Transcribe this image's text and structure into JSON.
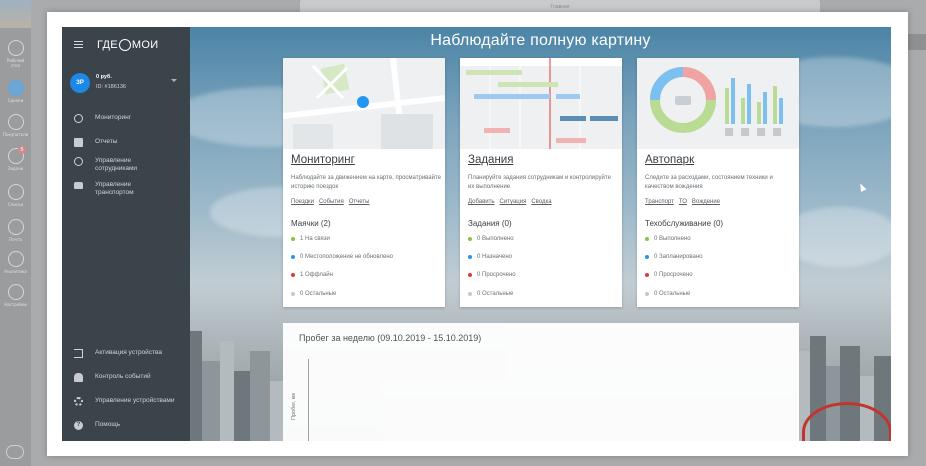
{
  "outer": {
    "tab_label": "Главная",
    "rail": [
      {
        "label": "Рабочий стол"
      },
      {
        "label": "Сделки"
      },
      {
        "label": "Покупатели"
      },
      {
        "label": "Задачи"
      },
      {
        "label": "Списки"
      },
      {
        "label": "Почта"
      },
      {
        "label": "Аналитика"
      },
      {
        "label": "Настройки"
      }
    ],
    "rail_badge": "5"
  },
  "sidebar": {
    "logo": {
      "left": "ГДЕ",
      "right": "МОИ"
    },
    "user": {
      "initials": "ЗР",
      "balance": "0 руб.",
      "account_id": "ID: #186136"
    },
    "nav": [
      {
        "label": "Мониторинг",
        "icon": "globe-icon"
      },
      {
        "label": "Отчеты",
        "icon": "document-icon"
      },
      {
        "label": "Управление сотрудниками",
        "icon": "person-icon"
      },
      {
        "label": "Управление транспортом",
        "icon": "car-icon"
      }
    ],
    "bottom_nav": [
      {
        "label": "Активация устройства",
        "icon": "exit-icon"
      },
      {
        "label": "Контроль событий",
        "icon": "bell-icon"
      },
      {
        "label": "Управление устройствами",
        "icon": "gear-icon"
      },
      {
        "label": "Помощь",
        "icon": "help-icon"
      }
    ]
  },
  "hero": {
    "title": "Наблюдайте полную картину"
  },
  "cards": [
    {
      "title": "Мониторинг",
      "description": "Наблюдайте за движением на карте, просматривайте историю поездок",
      "links": [
        "Поездки",
        "События",
        "Отчеты"
      ],
      "subtitle": "Маячки (2)",
      "stats": [
        {
          "text": "1 На связи",
          "color": "green"
        },
        {
          "text": "0 Местоположение не обновлено",
          "color": "blue"
        },
        {
          "text": "1 Оффлайн",
          "color": "red"
        },
        {
          "text": "0 Остальные",
          "color": "gray"
        }
      ]
    },
    {
      "title": "Задания",
      "description": "Планируйте задания сотрудникам и контролируйте их выполнение",
      "links": [
        "Добавить",
        "Ситуация",
        "Сводка"
      ],
      "subtitle": "Задания (0)",
      "stats": [
        {
          "text": "0 Выполнено",
          "color": "green"
        },
        {
          "text": "0 Назначено",
          "color": "blue"
        },
        {
          "text": "0 Просрочено",
          "color": "red"
        },
        {
          "text": "0 Остальные",
          "color": "gray"
        }
      ]
    },
    {
      "title": "Автопарк",
      "description": "Следите за расходами, состоянием техники и качеством вождения",
      "links": [
        "Транспорт",
        "ТО",
        "Вождение"
      ],
      "subtitle": "Техобслуживание (0)",
      "stats": [
        {
          "text": "0 Выполнено",
          "color": "green"
        },
        {
          "text": "0 Запланировано",
          "color": "blue"
        },
        {
          "text": "0 Просрочено",
          "color": "red"
        },
        {
          "text": "0 Остальные",
          "color": "gray"
        }
      ]
    }
  ],
  "mileage": {
    "title": "Пробег за неделю (09.10.2019 - 15.10.2019)",
    "ylabel": "Пробег, км"
  },
  "colors": {
    "sidebar": "#3b434b",
    "accent": "#1e88e5",
    "green": "#8bc34a",
    "blue": "#2196f3",
    "red": "#e53935",
    "gray": "#c5c9cc"
  }
}
